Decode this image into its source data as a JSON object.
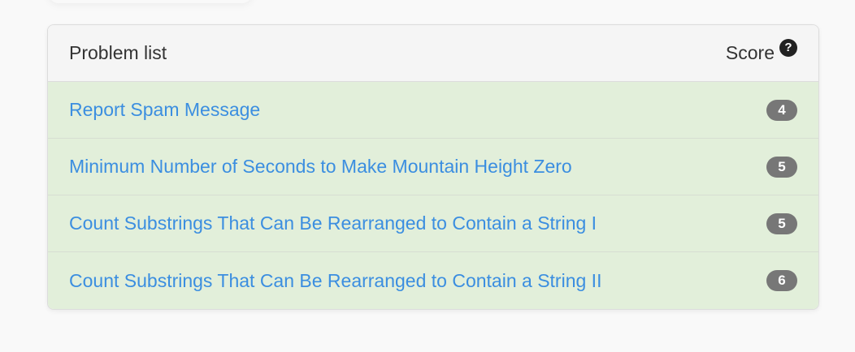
{
  "panel": {
    "title": "Problem list",
    "score_label": "Score",
    "help_icon": "question-circle-icon"
  },
  "problems": [
    {
      "title": "Report Spam Message",
      "score": "4"
    },
    {
      "title": "Minimum Number of Seconds to Make Mountain Height Zero",
      "score": "5"
    },
    {
      "title": "Count Substrings That Can Be Rearranged to Contain a String I",
      "score": "5"
    },
    {
      "title": "Count Substrings That Can Be Rearranged to Contain a String II",
      "score": "6"
    }
  ],
  "colors": {
    "row_background": "#e2efda",
    "link": "#3b8ee0",
    "badge": "#777777"
  }
}
